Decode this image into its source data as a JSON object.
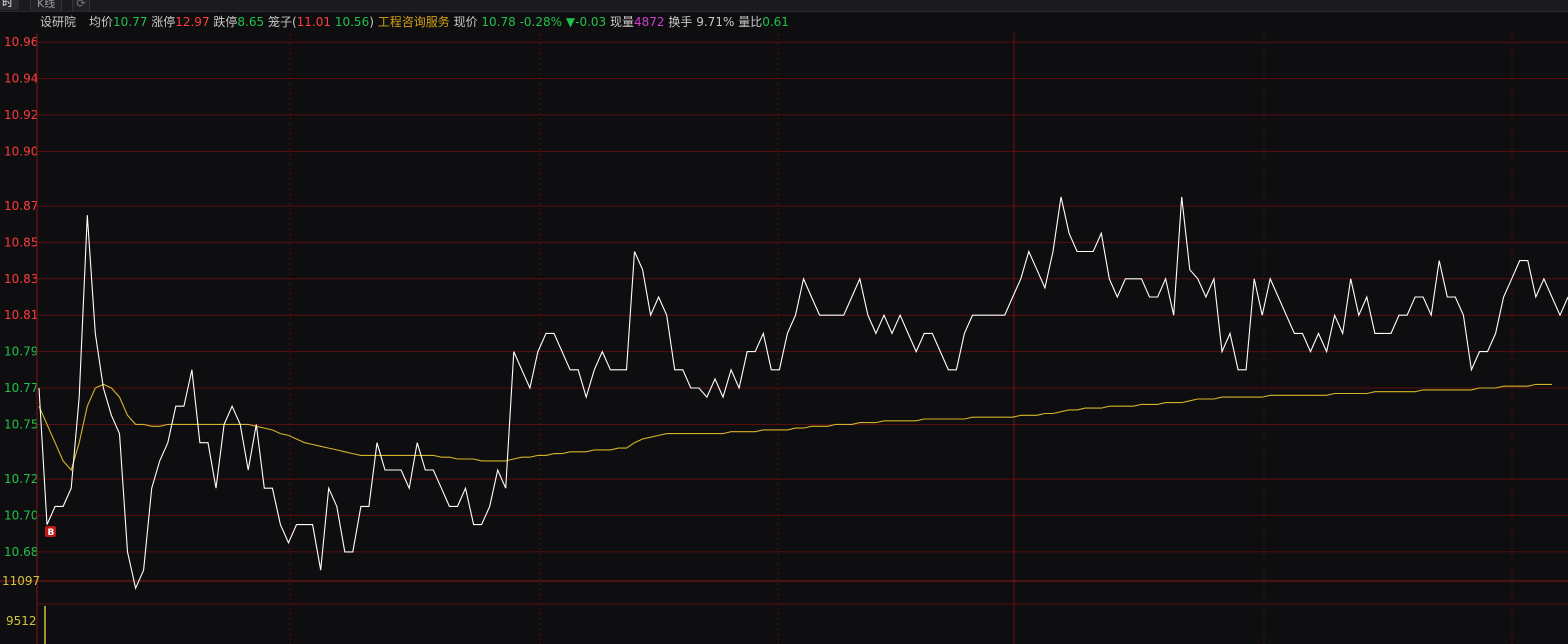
{
  "tabs": [
    {
      "label": "时",
      "active": true
    },
    {
      "label": "K线",
      "active": false
    }
  ],
  "info": {
    "name": "设研院",
    "avg_label": "均价",
    "avg_value": "10.77",
    "up_label": "涨停",
    "up_value": "12.97",
    "down_label": "跌停",
    "down_value": "8.65",
    "cage_label": "笼子(",
    "cage_hi": "11.01",
    "cage_lo": "10.56",
    "cage_close": ")",
    "sector": "工程咨询服务",
    "price_label": "现价",
    "price_value": "10.78",
    "pct": "-0.28%",
    "change_arrow": "▼",
    "change": "-0.03",
    "vol_label": "现量",
    "vol_value": "4872",
    "turnover_label": "换手",
    "turnover_value": "9.71%",
    "ratio_label": "量比",
    "ratio_value": "0.61"
  },
  "marker": "B",
  "colors": {
    "up": "#ff3b3b",
    "down": "#1fc24a",
    "avg_line": "#d4b429",
    "price_line": "#ffffff",
    "grid": "#5a0e0e",
    "volume": "#d4c23a",
    "sector": "#d4a017",
    "purple": "#d23bd2",
    "yellow": "#d4c23a"
  },
  "chart_data": {
    "type": "line",
    "title": "",
    "xlabel": "",
    "ylabel": "",
    "y_ticks": [
      "10.96",
      "10.94",
      "10.92",
      "10.90",
      "10.87",
      "10.85",
      "10.83",
      "10.81",
      "10.79",
      "10.77",
      "10.75",
      "10.72",
      "10.70",
      "10.68"
    ],
    "y_ticks_up": [
      "10.96",
      "10.94",
      "10.92",
      "10.90",
      "10.87",
      "10.85",
      "10.83",
      "10.81"
    ],
    "y_ticks_down": [
      "10.79",
      "10.77",
      "10.75",
      "10.72",
      "10.70",
      "10.68"
    ],
    "ylim": [
      10.675,
      10.965
    ],
    "prev_close": 10.81,
    "volume_ticks": [
      "11097",
      "9512"
    ],
    "grid": true,
    "series": [
      {
        "values": [
          10.77,
          10.695,
          10.705,
          10.705,
          10.715,
          10.765,
          10.865,
          10.8,
          10.77,
          10.755,
          10.745,
          10.68,
          10.66,
          10.67,
          10.715,
          10.73,
          10.74,
          10.76,
          10.76,
          10.78,
          10.74,
          10.74,
          10.715,
          10.75,
          10.76,
          10.75,
          10.725,
          10.75,
          10.715,
          10.715,
          10.695,
          10.685,
          10.695,
          10.695,
          10.695,
          10.67,
          10.715,
          10.705,
          10.68,
          10.68,
          10.705,
          10.705,
          10.74,
          10.725,
          10.725,
          10.725,
          10.715,
          10.74,
          10.725,
          10.725,
          10.715,
          10.705,
          10.705,
          10.715,
          10.695,
          10.695,
          10.705,
          10.725,
          10.715,
          10.79,
          10.78,
          10.77,
          10.79,
          10.8,
          10.8,
          10.79,
          10.78,
          10.78,
          10.765,
          10.78,
          10.79,
          10.78,
          10.78,
          10.78,
          10.845,
          10.835,
          10.81,
          10.82,
          10.81,
          10.78,
          10.78,
          10.77,
          10.77,
          10.765,
          10.775,
          10.765,
          10.78,
          10.77,
          10.79,
          10.79,
          10.8,
          10.78,
          10.78,
          10.8,
          10.81,
          10.83,
          10.82,
          10.81,
          10.81,
          10.81,
          10.81,
          10.82,
          10.83,
          10.81,
          10.8,
          10.81,
          10.8,
          10.81,
          10.8,
          10.79,
          10.8,
          10.8,
          10.79,
          10.78,
          10.78,
          10.8,
          10.81,
          10.81,
          10.81,
          10.81,
          10.81,
          10.82,
          10.83,
          10.845,
          10.835,
          10.825,
          10.845,
          10.875,
          10.855,
          10.845,
          10.845,
          10.845,
          10.855,
          10.83,
          10.82,
          10.83,
          10.83,
          10.83,
          10.82,
          10.82,
          10.83,
          10.81,
          10.875,
          10.835,
          10.83,
          10.82,
          10.83,
          10.79,
          10.8,
          10.78,
          10.78,
          10.83,
          10.81,
          10.83,
          10.82,
          10.81,
          10.8,
          10.8,
          10.79,
          10.8,
          10.79,
          10.81,
          10.8,
          10.83,
          10.81,
          10.82,
          10.8,
          10.8,
          10.8,
          10.81,
          10.81,
          10.82,
          10.82,
          10.81,
          10.84,
          10.82,
          10.82,
          10.81,
          10.78,
          10.79,
          10.79,
          10.8,
          10.82,
          10.83,
          10.84,
          10.84,
          10.82,
          10.83,
          10.82,
          10.81,
          10.82
        ]
      },
      {
        "values": [
          10.76,
          10.75,
          10.74,
          10.73,
          10.725,
          10.74,
          10.76,
          10.77,
          10.772,
          10.77,
          10.765,
          10.755,
          10.75,
          10.75,
          10.749,
          10.749,
          10.75,
          10.75,
          10.75,
          10.75,
          10.75,
          10.75,
          10.75,
          10.75,
          10.75,
          10.75,
          10.75,
          10.749,
          10.748,
          10.747,
          10.745,
          10.744,
          10.742,
          10.74,
          10.739,
          10.738,
          10.737,
          10.736,
          10.735,
          10.734,
          10.733,
          10.733,
          10.733,
          10.733,
          10.733,
          10.733,
          10.733,
          10.733,
          10.733,
          10.733,
          10.732,
          10.732,
          10.731,
          10.731,
          10.731,
          10.73,
          10.73,
          10.73,
          10.73,
          10.731,
          10.732,
          10.732,
          10.733,
          10.733,
          10.734,
          10.734,
          10.735,
          10.735,
          10.735,
          10.736,
          10.736,
          10.736,
          10.737,
          10.737,
          10.74,
          10.742,
          10.743,
          10.744,
          10.745,
          10.745,
          10.745,
          10.745,
          10.745,
          10.745,
          10.745,
          10.745,
          10.746,
          10.746,
          10.746,
          10.746,
          10.747,
          10.747,
          10.747,
          10.747,
          10.748,
          10.748,
          10.749,
          10.749,
          10.749,
          10.75,
          10.75,
          10.75,
          10.751,
          10.751,
          10.751,
          10.752,
          10.752,
          10.752,
          10.752,
          10.752,
          10.753,
          10.753,
          10.753,
          10.753,
          10.753,
          10.753,
          10.754,
          10.754,
          10.754,
          10.754,
          10.754,
          10.754,
          10.755,
          10.755,
          10.755,
          10.756,
          10.756,
          10.757,
          10.758,
          10.758,
          10.759,
          10.759,
          10.759,
          10.76,
          10.76,
          10.76,
          10.76,
          10.761,
          10.761,
          10.761,
          10.762,
          10.762,
          10.762,
          10.763,
          10.764,
          10.764,
          10.764,
          10.765,
          10.765,
          10.765,
          10.765,
          10.765,
          10.765,
          10.766,
          10.766,
          10.766,
          10.766,
          10.766,
          10.766,
          10.766,
          10.766,
          10.767,
          10.767,
          10.767,
          10.767,
          10.767,
          10.768,
          10.768,
          10.768,
          10.768,
          10.768,
          10.768,
          10.769,
          10.769,
          10.769,
          10.769,
          10.769,
          10.769,
          10.769,
          10.77,
          10.77,
          10.77,
          10.771,
          10.771,
          10.771,
          10.771,
          10.772,
          10.772,
          10.772
        ]
      }
    ],
    "volume_first_bar": 9512
  }
}
